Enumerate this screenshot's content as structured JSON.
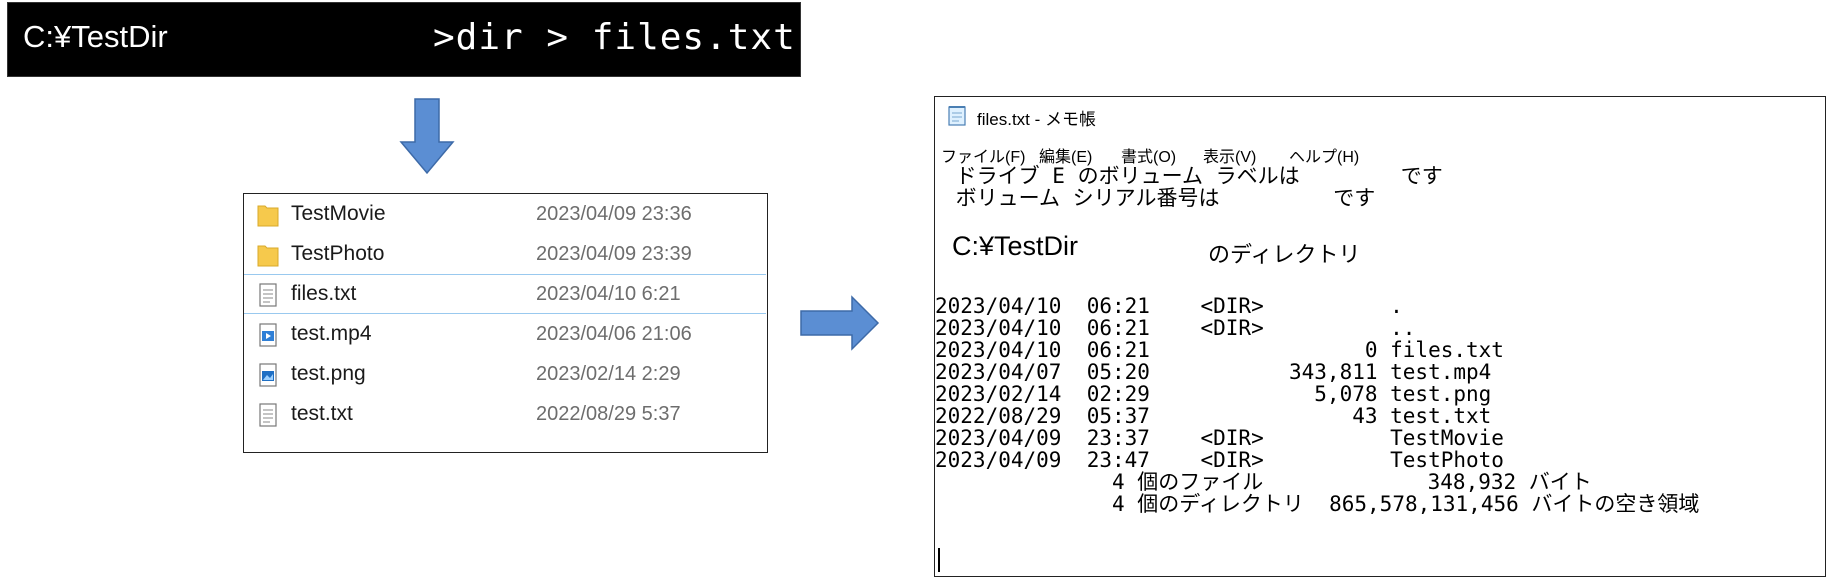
{
  "command_prompt": {
    "path": "C:¥TestDir",
    "command": ">dir > files.txt"
  },
  "explorer": {
    "files": [
      {
        "name": "TestMovie",
        "date": "2023/04/09 23:36",
        "icon": "folder-icon",
        "selected": false
      },
      {
        "name": "TestPhoto",
        "date": "2023/04/09 23:39",
        "icon": "folder-icon",
        "selected": false
      },
      {
        "name": "files.txt",
        "date": "2023/04/10 6:21",
        "icon": "text-file-icon",
        "selected": true
      },
      {
        "name": "test.mp4",
        "date": "2023/04/06 21:06",
        "icon": "video-file-icon",
        "selected": false
      },
      {
        "name": "test.png",
        "date": "2023/02/14 2:29",
        "icon": "image-file-icon",
        "selected": false
      },
      {
        "name": "test.txt",
        "date": "2022/08/29 5:37",
        "icon": "text-file-icon",
        "selected": false
      }
    ]
  },
  "notepad": {
    "title": "files.txt - メモ帳",
    "menu": [
      "ファイル(F)",
      "編集(E)",
      "書式(O)",
      "表示(V)",
      "ヘルプ(H)"
    ],
    "volume_label_line": " ドライブ E のボリューム ラベルは        です",
    "serial_line": " ボリューム シリアル番号は         です",
    "dir_path": "C:¥TestDir",
    "dir_suffix": "のディレクトリ",
    "listing": [
      "2023/04/10  06:21    <DIR>          .",
      "2023/04/10  06:21    <DIR>          ..",
      "2023/04/10  06:21                 0 files.txt",
      "2023/04/07  05:20           343,811 test.mp4",
      "2023/02/14  02:29             5,078 test.png",
      "2022/08/29  05:37                43 test.txt",
      "2023/04/09  23:37    <DIR>          TestMovie",
      "2023/04/09  23:47    <DIR>          TestPhoto",
      "              4 個のファイル             348,932 バイト",
      "              4 個のディレクトリ  865,578,131,456 バイトの空き領域"
    ]
  },
  "colors": {
    "arrow_fill": "#5b8ed3",
    "arrow_stroke": "#3d6aa8",
    "folder": "#f6c94c",
    "selection_border": "#99c9ef"
  }
}
